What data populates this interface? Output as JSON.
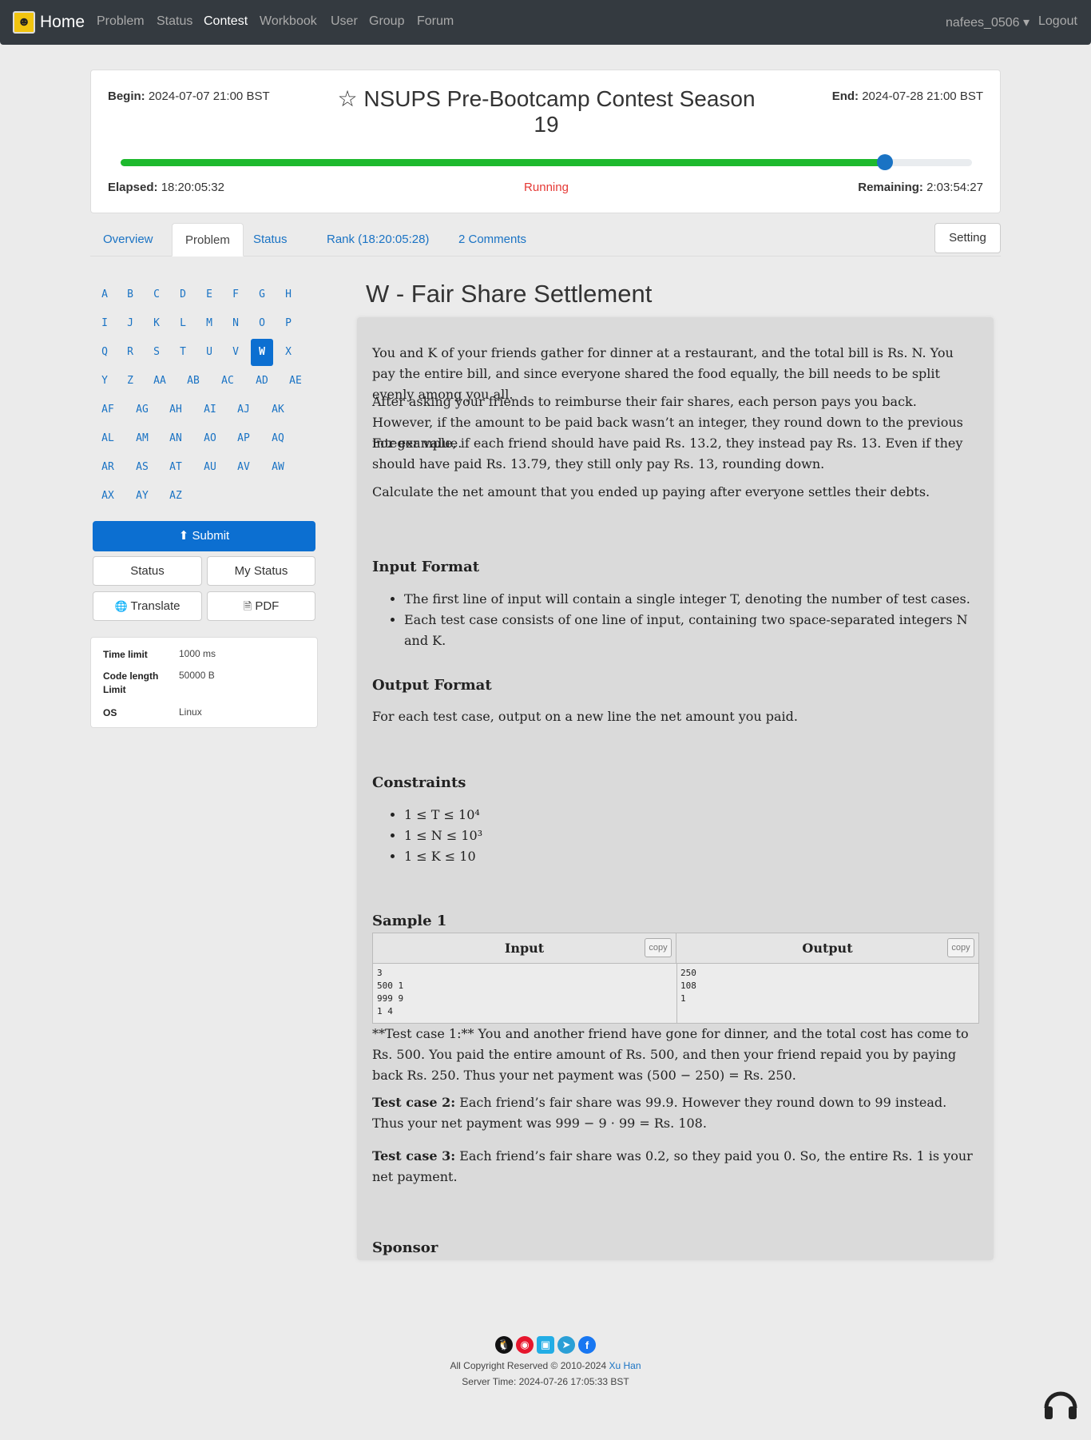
{
  "nav": {
    "brand": "Home",
    "links": [
      "Problem",
      "Status",
      "Contest",
      "Workbook",
      "User",
      "Group",
      "Forum"
    ],
    "user": "nafees_0506 ▾",
    "logout": "Logout"
  },
  "contest": {
    "begin_label": "Begin:",
    "begin": "2024-07-07 21:00 BST",
    "title": "NSUPS Pre-Bootcamp Contest Season 19",
    "end_label": "End:",
    "end": "2024-07-28 21:00 BST",
    "progress": 0.898,
    "elapsed_label": "Elapsed:",
    "elapsed": "18:20:05:32",
    "status": "Running",
    "remaining_label": "Remaining:",
    "remaining": "2:03:54:27"
  },
  "tabs": [
    "Overview",
    "Problem",
    "Status",
    "Rank (18:20:05:28)",
    "2 Comments"
  ],
  "setting": "Setting",
  "problem_letters": [
    "A",
    "B",
    "C",
    "D",
    "E",
    "F",
    "G",
    "H",
    "I",
    "J",
    "K",
    "L",
    "M",
    "N",
    "O",
    "P",
    "Q",
    "R",
    "S",
    "T",
    "U",
    "V",
    "W",
    "X",
    "Y",
    "Z",
    "AA",
    "AB",
    "AC",
    "AD",
    "AE",
    "AF",
    "AG",
    "AH",
    "AI",
    "AJ",
    "AK",
    "AL",
    "AM",
    "AN",
    "AO",
    "AP",
    "AQ",
    "AR",
    "AS",
    "AT",
    "AU",
    "AV",
    "AW",
    "AX",
    "AY",
    "AZ"
  ],
  "selected_letter": "W",
  "buttons": {
    "submit": "Submit",
    "status": "Status",
    "my_status": "My Status",
    "translate": "Translate",
    "pdf": "PDF"
  },
  "limits": {
    "time_label": "Time limit",
    "time": "1000 ms",
    "code_label": "Code length Limit",
    "code": "50000 B",
    "os_label": "OS",
    "os": "Linux"
  },
  "problem": {
    "title": "W - Fair Share Settlement",
    "p1": "You and K of your friends gather for dinner at a restaurant, and the total bill is Rs. N. You pay the entire bill, and since everyone shared the food equally, the bill needs to be split evenly among you all.",
    "p2": "After asking your friends to reimburse their fair shares, each person pays you back. However, if the amount to be paid back wasn’t an integer, they round down to the previous integer value.",
    "p3": "For example, if each friend should have paid Rs. 13.2, they instead pay Rs. 13. Even if they should have paid Rs. 13.79, they still only pay Rs. 13, rounding down.",
    "p4": "Calculate the net amount that you ended up paying after everyone settles their debts.",
    "input_h": "Input Format",
    "input_1": "The first line of input will contain a single integer T, denoting the number of test cases.",
    "input_2": "Each test case consists of one line of input, containing two space-separated integers N and K.",
    "output_h": "Output Format",
    "output_1": "For each test case, output on a new line the net amount you paid.",
    "constraints_h": "Constraints",
    "c1": "1 ≤ T ≤ 10⁴",
    "c2": "1 ≤ N ≤ 10³",
    "c3": "1 ≤ K ≤ 10",
    "sample_h": "Sample 1",
    "input_col": "Input",
    "output_col": "Output",
    "copy": "copy",
    "sample_in": "3\n500 1\n999 9\n1 4",
    "sample_out": "250\n108\n1",
    "e1": "**Test case 1:** You and another friend have gone for dinner, and the total cost has come to Rs. 500. You paid the entire amount of Rs. 500, and then your friend repaid you by paying back Rs. 250. Thus your net payment was (500 − 250) = Rs. 250.",
    "e2_b": "Test case 2:",
    "e2": " Each friend’s fair share was 99.9. However they round down to 99 instead. Thus your net payment was 999 − 9 · 99 = Rs. 108.",
    "e3_b": "Test case 3:",
    "e3": " Each friend’s fair share was 0.2, so they paid you 0. So, the entire Rs. 1 is your net payment.",
    "sponsor_h": "Sponsor"
  },
  "footer": {
    "copyright": "All Copyright Reserved © 2010-2024",
    "author": "Xu Han",
    "server_time": "Server Time: 2024-07-26 17:05:33 BST",
    "icons": [
      "qq-icon",
      "weibo-icon",
      "bilibili-icon",
      "telegram-icon",
      "facebook-icon"
    ]
  }
}
